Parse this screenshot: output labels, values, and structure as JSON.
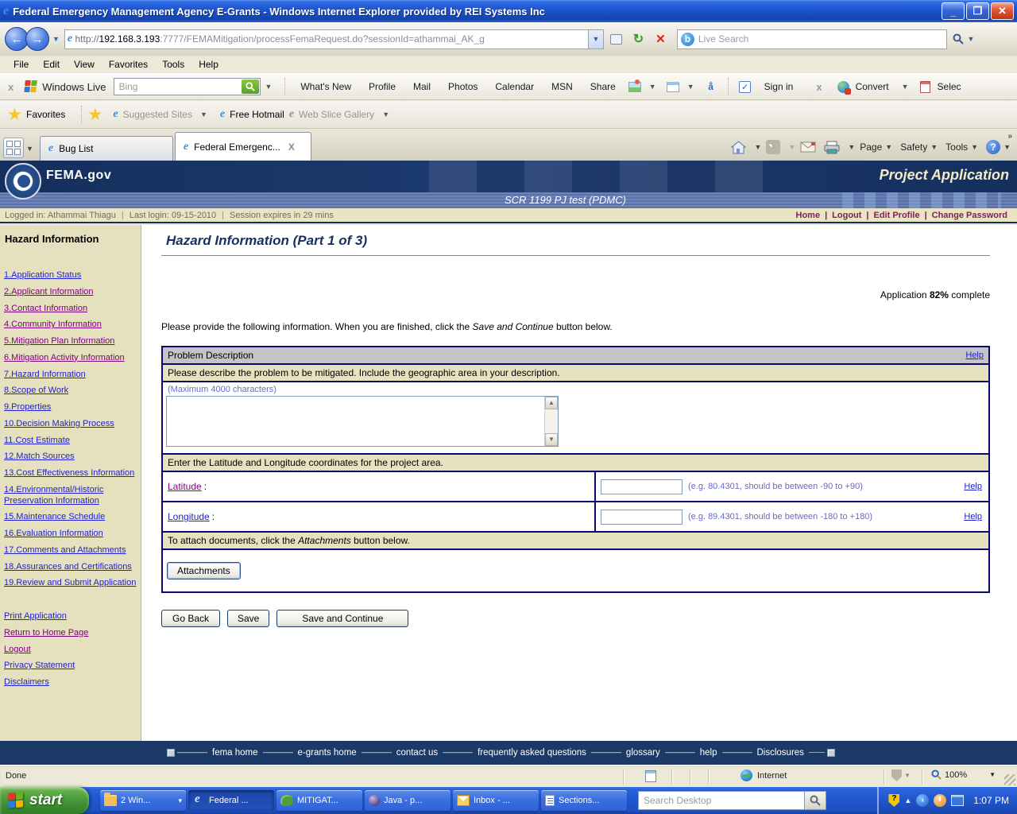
{
  "window": {
    "title": "Federal Emergency Management Agency E-Grants - Windows Internet Explorer provided by REI Systems Inc"
  },
  "address_bar": {
    "url_scheme": "http://",
    "url_host": "192.168.3.193",
    "url_rest": ":7777/FEMAMitigation/processFemaRequest.do?sessionId=athammai_AK_g",
    "search_placeholder": "Live Search"
  },
  "menu_bar": {
    "file": "File",
    "edit": "Edit",
    "view": "View",
    "favorites": "Favorites",
    "tools": "Tools",
    "help": "Help"
  },
  "live_toolbar": {
    "close": "x",
    "brand": "Windows Live",
    "search_placeholder": "Bing",
    "links": [
      {
        "label": "What's New"
      },
      {
        "label": "Profile"
      },
      {
        "label": "Mail"
      },
      {
        "label": "Photos"
      },
      {
        "label": "Calendar"
      },
      {
        "label": "MSN"
      },
      {
        "label": "Share"
      }
    ],
    "sign_in": "Sign in",
    "close2": "x",
    "convert": "Convert",
    "select": "Selec"
  },
  "favorites_bar": {
    "favorites_label": "Favorites",
    "suggested_sites": "Suggested Sites",
    "free_hotmail": "Free Hotmail",
    "web_slice": "Web Slice Gallery"
  },
  "tab_bar": {
    "tab_inactive": "Bug List",
    "tab_active": "Federal Emergenc...",
    "tab_close": "X",
    "page_menu": "Page",
    "safety_menu": "Safety",
    "tools_menu": "Tools",
    "more": "»"
  },
  "banner": {
    "site": "FEMA.gov",
    "app_title": "Project Application",
    "subtitle": "SCR 1199 PJ test (PDMC)"
  },
  "session_bar": {
    "logged_in": "Logged in: Athammai Thiagu",
    "last_login": "Last login: 09-15-2010",
    "expires": "Session expires in 29 mins",
    "links": {
      "home": "Home",
      "logout": "Logout",
      "edit_profile": "Edit Profile",
      "change_password": "Change Password"
    }
  },
  "sidebar": {
    "title": "Hazard Information",
    "items": [
      {
        "label": "1.Application Status",
        "state": "fresh"
      },
      {
        "label": "2.Applicant Information",
        "state": "visited"
      },
      {
        "label": "3.Contact Information",
        "state": "visited"
      },
      {
        "label": "4.Community Information",
        "state": "visited"
      },
      {
        "label": "5.Mitigation Plan Information",
        "state": "visited"
      },
      {
        "label": "6.Mitigation Activity Information",
        "state": "visited"
      },
      {
        "label": "7.Hazard Information",
        "state": "fresh"
      },
      {
        "label": "8.Scope of Work",
        "state": "fresh"
      },
      {
        "label": "9.Properties",
        "state": "fresh"
      },
      {
        "label": "10.Decision Making Process",
        "state": "fresh"
      },
      {
        "label": "11.Cost Estimate",
        "state": "fresh"
      },
      {
        "label": "12.Match Sources",
        "state": "fresh"
      },
      {
        "label": "13.Cost Effectiveness Information",
        "state": "fresh"
      },
      {
        "label": "14.Environmental/Historic Preservation Information",
        "state": "fresh"
      },
      {
        "label": "15.Maintenance Schedule",
        "state": "fresh"
      },
      {
        "label": "16.Evaluation Information",
        "state": "fresh"
      },
      {
        "label": "17.Comments and Attachments",
        "state": "fresh"
      },
      {
        "label": "18.Assurances and Certifications",
        "state": "fresh"
      },
      {
        "label": "19.Review and Submit Application",
        "state": "fresh"
      }
    ],
    "footer_links": [
      {
        "label": "Print Application",
        "state": "fresh"
      },
      {
        "label": "Return to Home Page",
        "state": "visited"
      },
      {
        "label": "Logout",
        "state": "visited"
      },
      {
        "label": "Privacy Statement",
        "state": "fresh"
      },
      {
        "label": "Disclaimers",
        "state": "fresh"
      }
    ]
  },
  "main": {
    "page_title": "Hazard Information (Part 1 of 3)",
    "progress_prefix": "Application ",
    "progress_value": "82%",
    "progress_suffix": " complete",
    "intro_before": "Please provide the following information. When you are finished, click the ",
    "intro_em": "Save and Continue",
    "intro_after": " button below.",
    "problem": {
      "header": "Problem Description",
      "help": "Help",
      "prompt": "Please describe the problem to be mitigated. Include the geographic area in your description.",
      "max_note": "(Maximum 4000 characters)",
      "textarea_value": ""
    },
    "coordinates": {
      "header": "Enter the Latitude and Longitude coordinates for the project area.",
      "latitude_label": "Latitude",
      "latitude_sep": ":",
      "latitude_value": "",
      "latitude_hint": "(e.g. 80.4301, should be between -90 to +90)",
      "latitude_help": "Help",
      "longitude_label": "Longitude",
      "longitude_sep": ":",
      "longitude_value": "",
      "longitude_hint": "(e.g. 89.4301, should be between -180 to +180)",
      "longitude_help": "Help"
    },
    "attachments": {
      "text_before": "To attach documents, click the ",
      "text_em": "Attachments",
      "text_after": " button below.",
      "button_label": "Attachments"
    },
    "actions": {
      "go_back": "Go Back",
      "save": "Save",
      "save_and_continue": "Save and Continue"
    }
  },
  "footer": {
    "links": [
      {
        "label": "fema home"
      },
      {
        "label": "e-grants home"
      },
      {
        "label": "contact us"
      },
      {
        "label": "frequently asked questions"
      },
      {
        "label": "glossary"
      },
      {
        "label": "help"
      },
      {
        "label": "Disclosures"
      }
    ]
  },
  "status_bar": {
    "text": "Done",
    "zone": "Internet",
    "zoom": "100%"
  },
  "taskbar": {
    "start": "start",
    "tasks": [
      {
        "label": "2 Win...",
        "icon": "folder",
        "state": "normal",
        "arrow": "▾"
      },
      {
        "label": "Federal ...",
        "icon": "ie",
        "state": "active"
      },
      {
        "label": "MITIGAT...",
        "icon": "app",
        "state": "normal"
      },
      {
        "label": "Java - p...",
        "icon": "java",
        "state": "normal"
      },
      {
        "label": "Inbox - ...",
        "icon": "mail",
        "state": "normal"
      },
      {
        "label": "Sections...",
        "icon": "doc",
        "state": "normal"
      }
    ],
    "search_placeholder": "Search Desktop",
    "time": "1:07 PM"
  }
}
